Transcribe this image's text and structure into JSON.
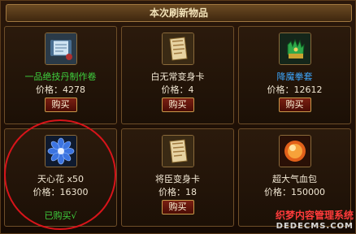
{
  "panel": {
    "title": "本次刷新物品"
  },
  "button_label": "购买",
  "items": [
    {
      "name": "一品绝技丹制作卷",
      "price_label": "价格：",
      "price": "4278",
      "icon": "scroll-icon",
      "status": "buy"
    },
    {
      "name": "白无常变身卡",
      "price_label": "价格：",
      "price": "4",
      "icon": "transform-card-icon",
      "status": "buy"
    },
    {
      "name": "降魔拳套",
      "price_label": "价格：",
      "price": "12612",
      "icon": "gauntlet-icon",
      "status": "buy"
    },
    {
      "name": "天心花 x50",
      "price_label": "价格：",
      "price": "16300",
      "icon": "blue-flower-icon",
      "status": "bought",
      "bought_label": "已购买√"
    },
    {
      "name": "将臣变身卡",
      "price_label": "价格：",
      "price": "18",
      "icon": "transform-card-icon",
      "status": "buy"
    },
    {
      "name": "超大气血包",
      "price_label": "价格：",
      "price": "150000",
      "icon": "health-orb-icon",
      "status": "none"
    }
  ],
  "colors": {
    "green_name": "#3fd23f",
    "blue_name": "#3ea8ff",
    "highlight_circle": "#d8141a"
  },
  "watermark": {
    "line1": "织梦内容管理系统",
    "line2": "DEDECMS.COM"
  }
}
